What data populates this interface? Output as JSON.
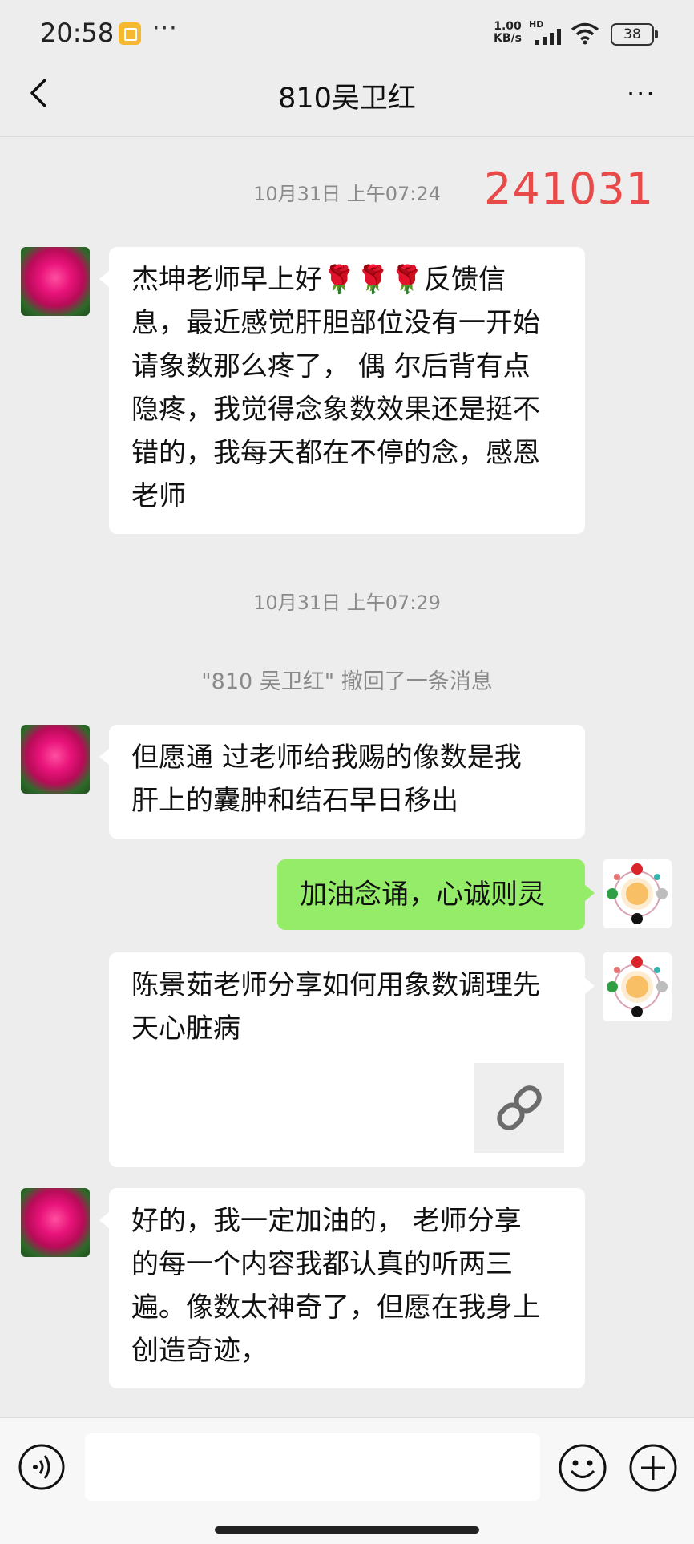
{
  "status_bar": {
    "time": "20:58",
    "more_dots": "···",
    "net_speed_value": "1.00",
    "net_speed_unit": "KB/s",
    "hd_label": "HD",
    "battery": "38",
    "icons": [
      "notification-icon",
      "signal-icon",
      "wifi-icon",
      "battery-icon"
    ]
  },
  "nav": {
    "title": "810吴卫红",
    "more": "···",
    "back_icon": "chevron-left-icon"
  },
  "chat": {
    "timestamp1": "10月31日 上午07:24",
    "annotation": "241031",
    "message1": "杰坤老师早上好🌹🌹🌹反馈信息，最近感觉肝胆部位没有一开始请象数那么疼了， 偶 尔后背有点隐疼，我觉得念象数效果还是挺不错的，我每天都在不停的念，感恩老师",
    "message1_lines": [
      "杰坤老师早上好🌹🌹🌹反馈信",
      "息，最近感觉肝胆部位没有一开始",
      "请象数那么疼了， 偶 尔后背有点",
      "隐疼，我觉得念象数效果还是挺不",
      "错的，我每天都在不停的念，感恩",
      "老师"
    ],
    "timestamp2": "10月31日 上午07:29",
    "recall_notice": "\"810 吴卫红\" 撤回了一条消息",
    "message2_lines": [
      "但愿通 过老师给我赐的像数是我",
      "肝上的囊肿和结石早日移出"
    ],
    "my_message": "加油念诵，心诚则灵",
    "link_title_lines": [
      "陈景茹老师分享如何用象数调理先",
      "天心脏病"
    ],
    "message3_lines": [
      "好的，我一定加油的，  老师分享",
      "的每一个内容我都认真的听两三",
      "遍。像数太神奇了，但愿在我身上",
      "创造奇迹，"
    ]
  },
  "bottom_bar": {
    "icons": [
      "voice-icon",
      "emoji-icon",
      "plus-icon"
    ],
    "input_value": ""
  },
  "colors": {
    "background": "#ededed",
    "my_bubble": "#95ec69",
    "annotation": "#e84a4a"
  }
}
